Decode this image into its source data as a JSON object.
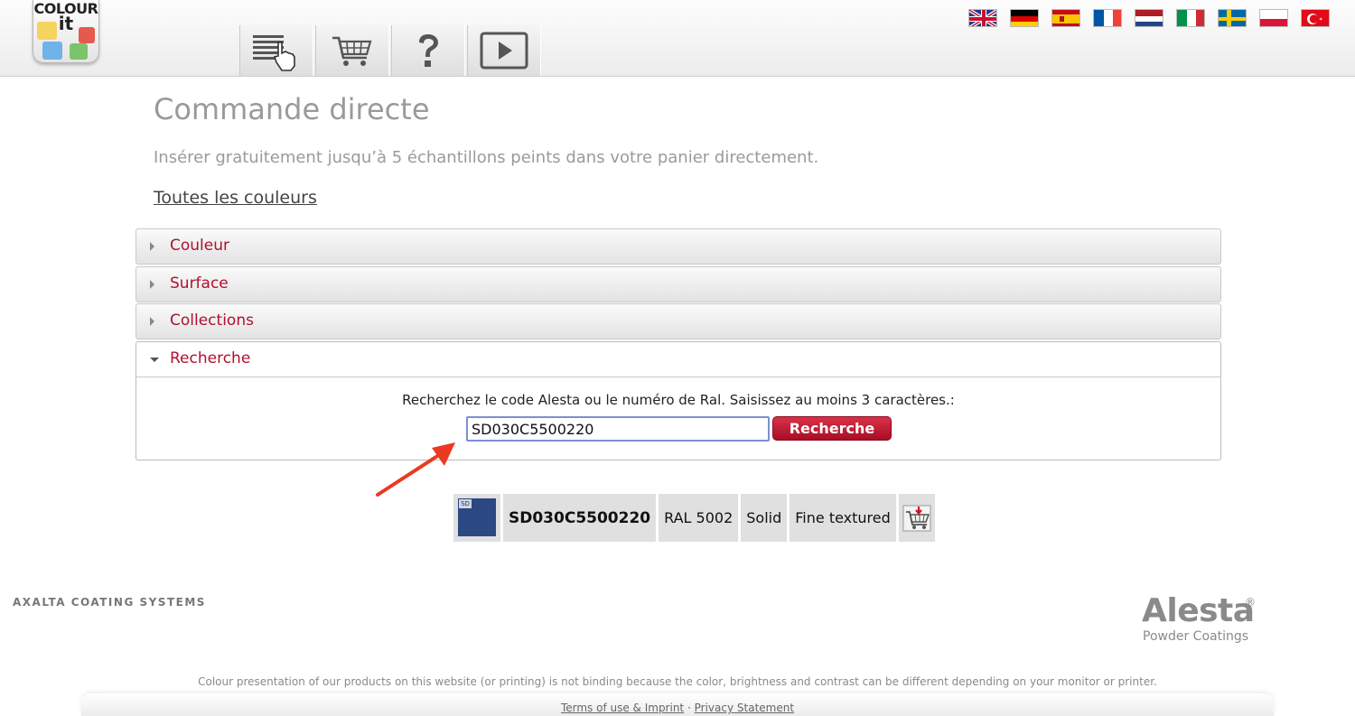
{
  "header": {
    "logo": {
      "line1": "COLOUR",
      "line2": "it"
    },
    "nav": [
      {
        "name": "colour-list",
        "icon": "list-pointer-icon"
      },
      {
        "name": "cart",
        "icon": "shopping-cart-icon"
      },
      {
        "name": "help",
        "icon": "question-mark-icon"
      },
      {
        "name": "video",
        "icon": "play-icon"
      }
    ],
    "languages": [
      "en",
      "de",
      "es",
      "fr",
      "nl",
      "it",
      "sv",
      "pl",
      "tr"
    ]
  },
  "main": {
    "title": "Commande directe",
    "subtitle": "Insérer gratuitement jusqu’à 5 échantillons peints dans votre panier directement.",
    "all_colours_link": "Toutes les couleurs",
    "accordion": [
      {
        "label": "Couleur",
        "open": false
      },
      {
        "label": "Surface",
        "open": false
      },
      {
        "label": "Collections",
        "open": false
      },
      {
        "label": "Recherche",
        "open": true
      }
    ],
    "search": {
      "hint": "Recherchez le code Alesta ou le numéro de Ral. Saisissez au moins 3 caractères.:",
      "value": "SD030C5500220",
      "button_label": "Recherche"
    },
    "result": {
      "badge": "SD",
      "swatch_color": "#2c4882",
      "code": "SD030C5500220",
      "ral": "RAL 5002",
      "finish": "Solid",
      "texture": "Fine textured"
    }
  },
  "footer": {
    "company": "AXALTA COATING SYSTEMS",
    "brand": "Alesta",
    "brand_mark": "®",
    "brand_sub": "Powder Coatings",
    "disclaimer": "Colour presentation of our products on this website (or printing) is not binding because the color, brightness and contrast can be different depending on your monitor or printer.",
    "links": {
      "terms": "Terms of use & Imprint",
      "separator": "·",
      "privacy": "Privacy Statement"
    }
  },
  "colors": {
    "accent": "#b0102e",
    "button": "#c21d36",
    "annotation": "#ea3a22"
  }
}
